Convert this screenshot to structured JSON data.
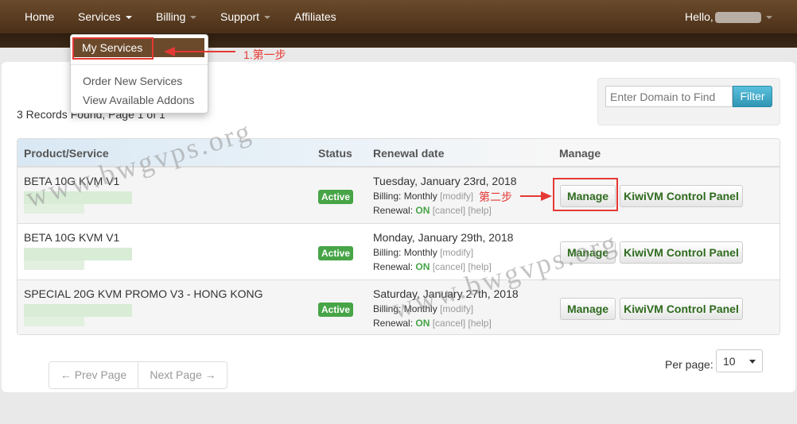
{
  "nav": {
    "home": "Home",
    "services": "Services",
    "billing": "Billing",
    "support": "Support",
    "affiliates": "Affiliates",
    "hello": "Hello,"
  },
  "services_menu": {
    "my_services": "My Services",
    "order_new": "Order New Services",
    "view_addons": "View Available Addons"
  },
  "records_text": "3 Records Found, Page 1 of 1",
  "filter": {
    "placeholder": "Enter Domain to Find",
    "button": "Filter"
  },
  "table": {
    "headers": {
      "product": "Product/Service",
      "status": "Status",
      "renewal": "Renewal date",
      "manage": "Manage"
    },
    "rows": [
      {
        "product": "BETA 10G KVM V1",
        "status": "Active",
        "date": "Tuesday, January 23rd, 2018",
        "billing_label": "Billing:",
        "billing_value": "Monthly",
        "modify": "[modify]",
        "renewal_label": "Renewal:",
        "renewal_state": "ON",
        "cancel": "[cancel]",
        "help": "[help]",
        "manage_button": "Manage",
        "panel_button": "KiwiVM Control Panel"
      },
      {
        "product": "BETA 10G KVM V1",
        "status": "Active",
        "date": "Monday, January 29th, 2018",
        "billing_label": "Billing:",
        "billing_value": "Monthly",
        "modify": "[modify]",
        "renewal_label": "Renewal:",
        "renewal_state": "ON",
        "cancel": "[cancel]",
        "help": "[help]",
        "manage_button": "Manage",
        "panel_button": "KiwiVM Control Panel"
      },
      {
        "product": "SPECIAL 20G KVM PROMO V3 - HONG KONG",
        "status": "Active",
        "date": "Saturday, January 27th, 2018",
        "billing_label": "Billing:",
        "billing_value": "Monthly",
        "modify": "[modify]",
        "renewal_label": "Renewal:",
        "renewal_state": "ON",
        "cancel": "[cancel]",
        "help": "[help]",
        "manage_button": "Manage",
        "panel_button": "KiwiVM Control Panel"
      }
    ]
  },
  "pagination": {
    "prev": "← Prev Page",
    "next": "Next Page →",
    "per_page_label": "Per page:",
    "per_page_value": "10"
  },
  "annotations": {
    "step1": "1.第一步",
    "step2": "第二步"
  },
  "watermark": "www.bwgvps.org",
  "colors": {
    "nav_bg": "#5a3c22",
    "active_badge": "#47a447",
    "annotation_red": "#e53935",
    "filter_button": "#2f96b4"
  }
}
